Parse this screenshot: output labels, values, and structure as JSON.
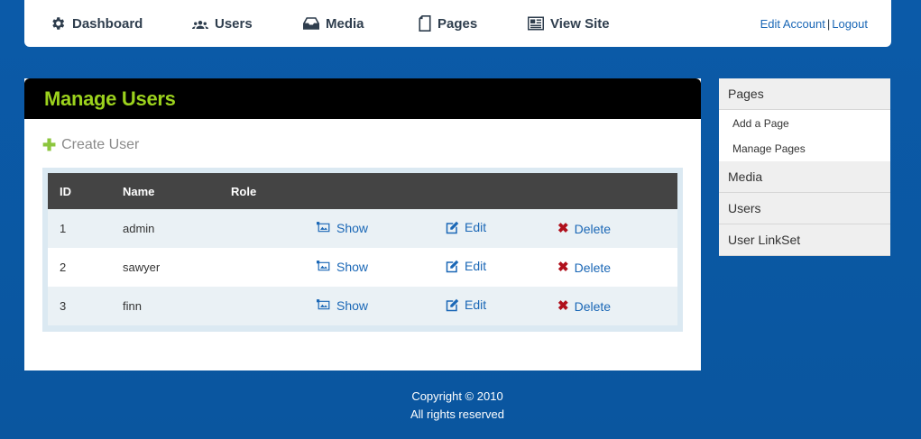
{
  "nav": {
    "items": [
      {
        "label": "Dashboard",
        "icon": "gear-icon"
      },
      {
        "label": "Users",
        "icon": "users-icon"
      },
      {
        "label": "Media",
        "icon": "inbox-icon"
      },
      {
        "label": "Pages",
        "icon": "page-icon"
      },
      {
        "label": "View Site",
        "icon": "newspaper-icon"
      }
    ],
    "account": {
      "edit": "Edit Account",
      "separator": "|",
      "logout": "Logout"
    }
  },
  "main": {
    "title": "Manage Users",
    "create_label": "Create User",
    "table": {
      "columns": [
        "ID",
        "Name",
        "Role"
      ],
      "actions": {
        "show": "Show",
        "edit": "Edit",
        "delete": "Delete"
      },
      "rows": [
        {
          "id": "1",
          "name": "admin",
          "role": ""
        },
        {
          "id": "2",
          "name": "sawyer",
          "role": ""
        },
        {
          "id": "3",
          "name": "finn",
          "role": ""
        }
      ]
    }
  },
  "sidebar": {
    "sections": [
      {
        "label": "Pages",
        "items": [
          "Add a Page",
          "Manage Pages"
        ]
      },
      {
        "label": "Media",
        "items": []
      },
      {
        "label": "Users",
        "items": []
      },
      {
        "label": "User LinkSet",
        "items": []
      }
    ]
  },
  "footer": {
    "line1": "Copyright © 2010",
    "line2": "All rights reserved"
  },
  "colors": {
    "background": "#0c59a6",
    "title_green": "#9cd21d",
    "link_blue": "#1a67b6",
    "delete_red": "#b0101c",
    "plus_green": "#8cc63e"
  }
}
